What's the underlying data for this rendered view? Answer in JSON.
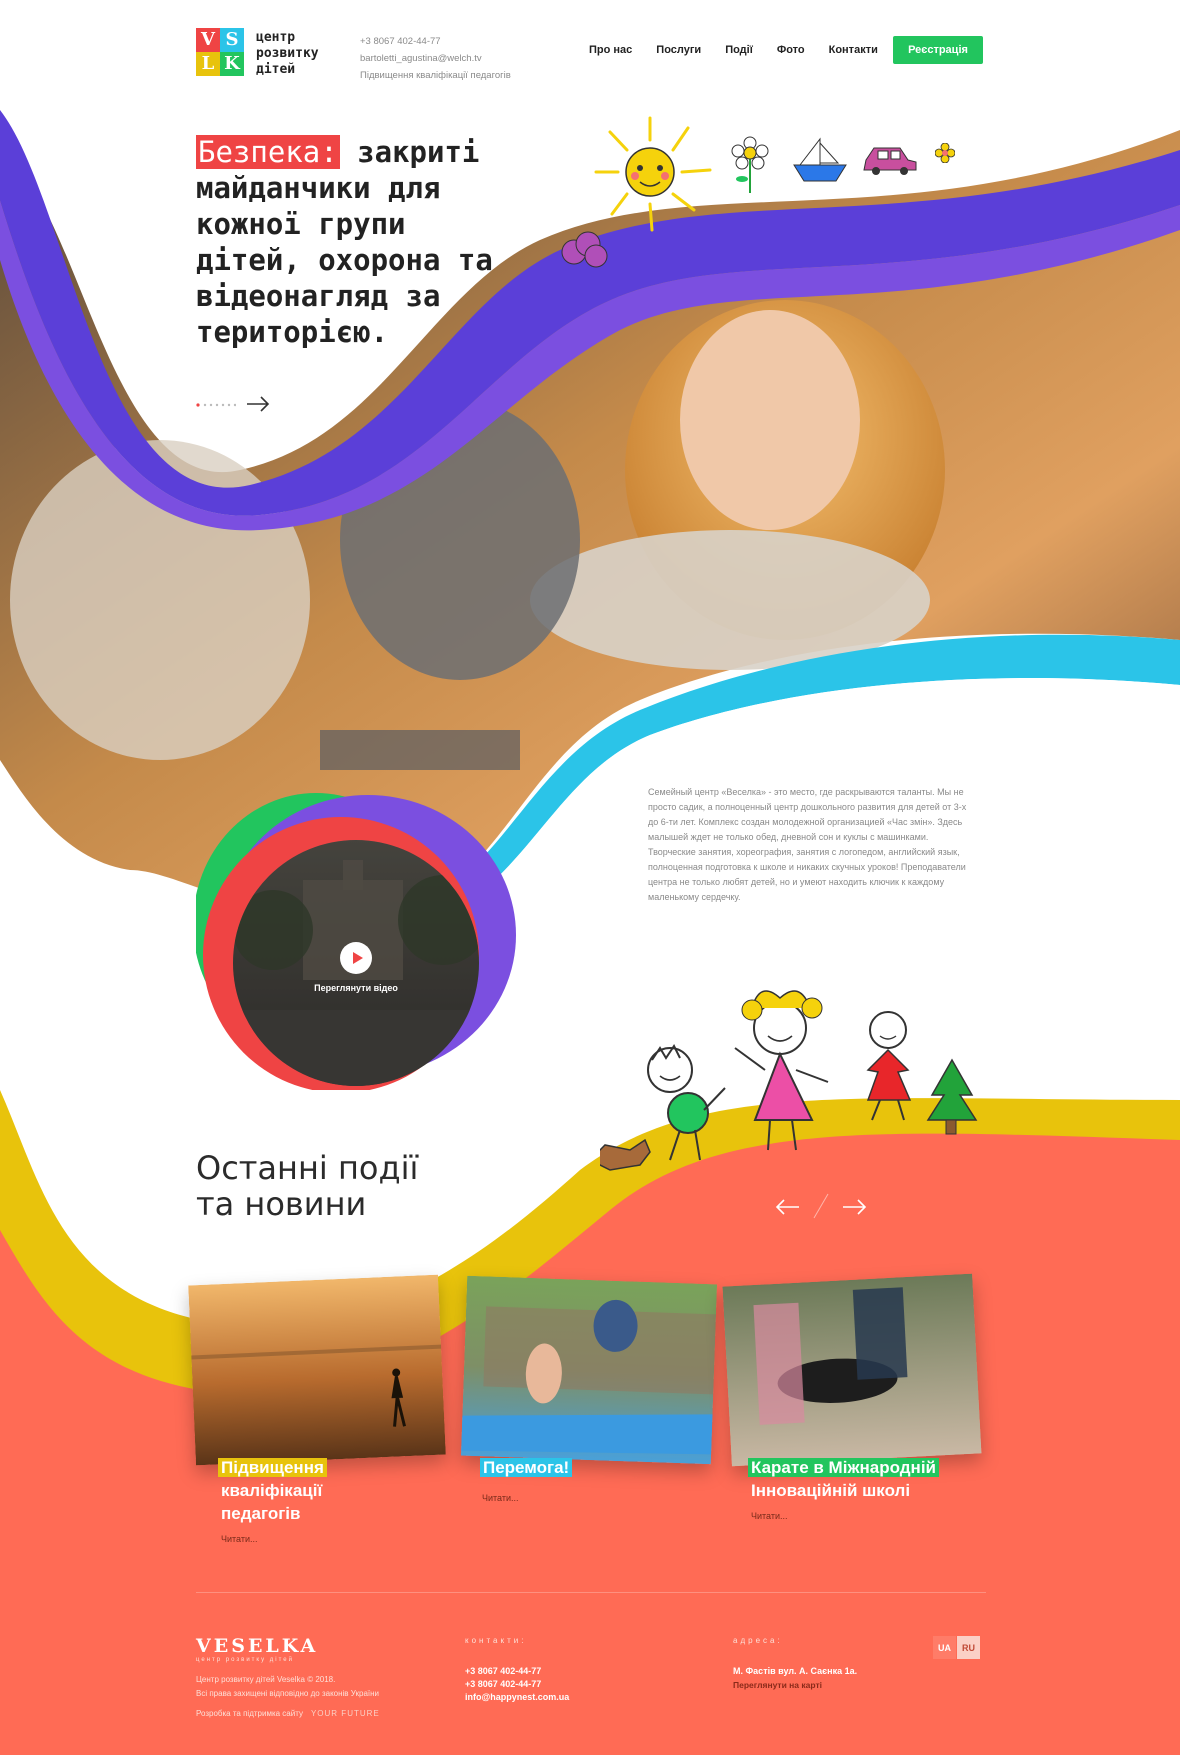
{
  "header": {
    "logo_text_lines": [
      "центр",
      "розвитку",
      "дітей"
    ],
    "logo_letters": [
      "V",
      "S",
      "L",
      "K"
    ],
    "phone": "+3 8067 402-44-77",
    "email": "bartoletti_agustina@welch.tv",
    "tagline": "Підвищення кваліфікації педагогів",
    "nav": [
      "Про нас",
      "Послуги",
      "Події",
      "Фото",
      "Контакти"
    ],
    "register_label": "Реєстрація"
  },
  "hero": {
    "title_highlight": "Безпека:",
    "title_rest": "закриті майданчики для кожної групи дітей, охорона та відеонагляд за територією."
  },
  "about": {
    "text": "Семейный центр «Веселка» - это место, где раскрываются таланты. Мы не просто садик, а полноценный центр дошкольного развития для детей от 3-х до 6-ти лет. Комплекс создан молодежной организацией «Час змін». Здесь малышей ждет не только обед, дневной сон и куклы с машинками. Творческие занятия, хореография, занятия с логопедом, английский язык, полноценная подготовка к школе и никаких скучных уроков! Преподаватели центра не только любят детей, но и умеют находить ключик к каждому маленькому сердечку."
  },
  "video": {
    "label": "Переглянути відео"
  },
  "events": {
    "title_line1": "Останні події",
    "title_line2": "та новини",
    "cards": [
      {
        "title": "Підвищення кваліфікації педагогів",
        "title_lines": [
          "Підвищення",
          "кваліфікації",
          "педагогів"
        ],
        "read": "Читати...",
        "color": "#e8c30c"
      },
      {
        "title": "Перемога!",
        "title_lines": [
          "Перемога!"
        ],
        "read": "Читати...",
        "color": "#2bc4e8"
      },
      {
        "title": "Карате в Міжнародній Інноваційній школі",
        "title_lines": [
          "Карате в Міжнародній",
          "Інноваційній школі"
        ],
        "read": "Читати...",
        "color": "#22c55e"
      }
    ]
  },
  "footer": {
    "logo": "VESELKA",
    "logo_sub": "центр розвитку дітей",
    "copyright": "Центр розвитку дітей Veselka © 2018.",
    "rights": "Всі права захищені відповідно до законів України",
    "dev": "Розробка та підтримка сайту",
    "dev_brand": "YOUR FUTURE",
    "contacts_head": "контакти:",
    "phone1": "+3 8067 402-44-77",
    "phone2": "+3 8067 402-44-77",
    "email": "info@happynest.com.ua",
    "address_head": "адреса:",
    "address": "М. Фастів вул. А. Саєнка 1а.",
    "map_link": "Переглянути на карті",
    "lang_ua": "UA",
    "lang_ru": "RU"
  },
  "colors": {
    "purple": "#5b3fd8",
    "violet": "#7b4fe0",
    "cyan": "#2bc4e8",
    "yellow": "#e8c30c",
    "coral": "#ff6b55",
    "green": "#22c55e",
    "red": "#ef4444"
  },
  "icons": [
    "play-icon",
    "arrow-right-icon",
    "arrow-left-icon",
    "sun-doodle",
    "flower-doodle",
    "boat-doodle",
    "car-doodle",
    "kids-doodle"
  ]
}
